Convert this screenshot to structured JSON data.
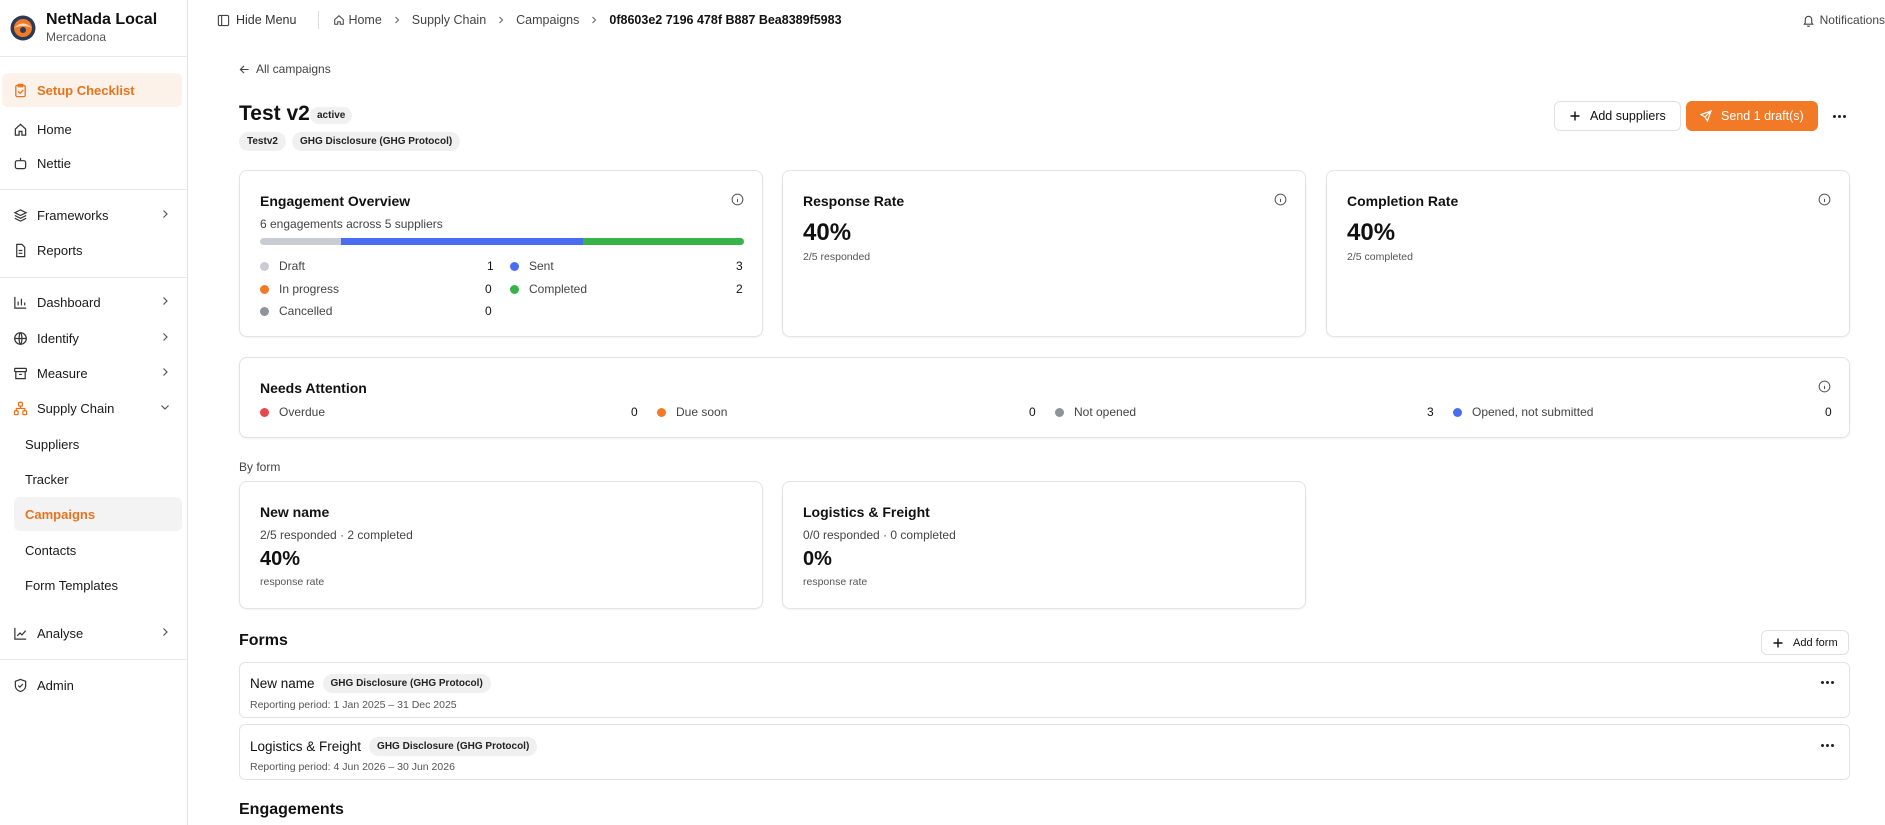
{
  "brand": {
    "name": "NetNada Local",
    "org": "Mercadona"
  },
  "sidebar": {
    "setup": "Setup Checklist",
    "home": "Home",
    "nettie": "Nettie",
    "frameworks": "Frameworks",
    "reports": "Reports",
    "dashboard": "Dashboard",
    "identify": "Identify",
    "measure": "Measure",
    "supply_chain": "Supply Chain",
    "suppliers": "Suppliers",
    "tracker": "Tracker",
    "campaigns": "Campaigns",
    "contacts": "Contacts",
    "form_templates": "Form Templates",
    "analyse": "Analyse",
    "admin": "Admin"
  },
  "topbar": {
    "hide_menu": "Hide Menu",
    "crumbs": [
      "Home",
      "Supply Chain",
      "Campaigns"
    ],
    "current": "0f8603e2 7196 478f B887 Bea8389f5983",
    "notifications": "Notifications"
  },
  "campaign": {
    "back": "All campaigns",
    "title": "Test v2",
    "status": "active",
    "tags": [
      "Testv2",
      "GHG Disclosure (GHG Protocol)"
    ],
    "add_suppliers": "Add suppliers",
    "send_drafts": "Send 1 draft(s)"
  },
  "engagement": {
    "title": "Engagement Overview",
    "subtitle": "6 engagements across 5 suppliers",
    "bar": {
      "draft": 1,
      "sent": 3,
      "completed": 2
    },
    "items": [
      {
        "label": "Draft",
        "value": "1"
      },
      {
        "label": "Sent",
        "value": "3"
      },
      {
        "label": "In progress",
        "value": "0"
      },
      {
        "label": "Completed",
        "value": "2"
      },
      {
        "label": "Cancelled",
        "value": "0"
      }
    ]
  },
  "response_rate": {
    "title": "Response Rate",
    "value": "40%",
    "sub": "2/5 responded"
  },
  "completion_rate": {
    "title": "Completion Rate",
    "value": "40%",
    "sub": "2/5 completed"
  },
  "attention": {
    "title": "Needs Attention",
    "items": [
      {
        "label": "Overdue",
        "value": "0"
      },
      {
        "label": "Due soon",
        "value": "0"
      },
      {
        "label": "Not opened",
        "value": "3"
      },
      {
        "label": "Opened, not submitted",
        "value": "0"
      }
    ]
  },
  "by_form": {
    "label": "By form",
    "cards": [
      {
        "name": "New name",
        "stats": "2/5 responded · 2 completed",
        "rate": "40%",
        "rate_label": "response rate"
      },
      {
        "name": "Logistics & Freight",
        "stats": "0/0 responded · 0 completed",
        "rate": "0%",
        "rate_label": "response rate"
      }
    ]
  },
  "forms": {
    "title": "Forms",
    "add": "Add form",
    "rows": [
      {
        "name": "New name",
        "tag": "GHG Disclosure (GHG Protocol)",
        "period": "Reporting period: 1 Jan 2025 – 31 Dec 2025"
      },
      {
        "name": "Logistics & Freight",
        "tag": "GHG Disclosure (GHG Protocol)",
        "period": "Reporting period: 4 Jun 2026 – 30 Jun 2026"
      }
    ]
  },
  "engagements_title": "Engagements",
  "colors": {
    "accent": "#f27a26",
    "draft": "#c9ccd3",
    "sent": "#4a6cf0",
    "completed": "#37b34a",
    "in_progress": "#f27a26",
    "cancelled": "#8e9299",
    "overdue": "#e5484d",
    "due_soon": "#f27a26",
    "not_opened": "#8e9299",
    "opened": "#4a6cf0"
  }
}
